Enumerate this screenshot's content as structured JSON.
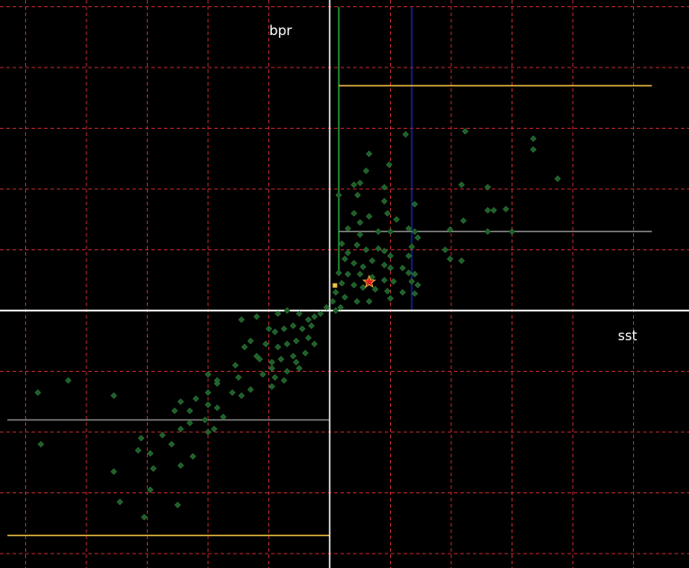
{
  "chart_data": {
    "type": "scatter",
    "title": "",
    "xlabel": "sst",
    "ylabel": "bpr",
    "grid": true,
    "legend": "none",
    "xlim": [
      -5.4,
      5.8
    ],
    "ylim": [
      -4.2,
      5.0
    ],
    "origin": [
      0,
      0
    ],
    "colors": {
      "background": "#000000",
      "grid": "#c0272d",
      "axes": "#ffffff",
      "points": "#1f5f2a",
      "highlight_star": "#e02020",
      "green_line": "#2fd04a",
      "blue_line": "#1a2ad0",
      "yellow_line": "#f0c040",
      "gray_line": "#8a8a8a"
    },
    "reference_lines": [
      {
        "kind": "vertical",
        "x": 0.15,
        "y_range": [
          0.6,
          5.0
        ],
        "color": "green"
      },
      {
        "kind": "vertical",
        "x": 1.35,
        "y_range": [
          0.0,
          5.0
        ],
        "color": "blue"
      },
      {
        "kind": "horizontal",
        "y": 3.7,
        "x_range": [
          0.15,
          5.3
        ],
        "color": "yellow"
      },
      {
        "kind": "horizontal",
        "y": 1.3,
        "x_range": [
          0.15,
          5.3
        ],
        "color": "gray"
      },
      {
        "kind": "horizontal",
        "y": -1.8,
        "x_range": [
          -5.3,
          0.0
        ],
        "color": "gray"
      },
      {
        "kind": "horizontal",
        "y": -3.7,
        "x_range": [
          -5.3,
          0.0
        ],
        "color": "yellow"
      }
    ],
    "highlight": {
      "x": 0.65,
      "y": 0.47,
      "marker": "star"
    },
    "points": [
      [
        1.25,
        2.9
      ],
      [
        0.65,
        2.58
      ],
      [
        0.98,
        2.4
      ],
      [
        2.23,
        2.95
      ],
      [
        3.35,
        2.83
      ],
      [
        3.35,
        2.65
      ],
      [
        3.75,
        2.17
      ],
      [
        2.17,
        2.07
      ],
      [
        2.6,
        2.03
      ],
      [
        0.15,
        1.9
      ],
      [
        0.4,
        2.07
      ],
      [
        0.46,
        1.9
      ],
      [
        0.9,
        2.03
      ],
      [
        0.9,
        1.8
      ],
      [
        1.4,
        1.75
      ],
      [
        2.7,
        1.65
      ],
      [
        2.6,
        1.65
      ],
      [
        2.9,
        1.67
      ],
      [
        0.4,
        1.6
      ],
      [
        0.5,
        1.45
      ],
      [
        0.65,
        1.55
      ],
      [
        0.95,
        1.6
      ],
      [
        1.1,
        1.5
      ],
      [
        2.2,
        1.48
      ],
      [
        1.98,
        1.33
      ],
      [
        2.6,
        1.3
      ],
      [
        3.0,
        1.3
      ],
      [
        0.3,
        1.35
      ],
      [
        0.5,
        1.25
      ],
      [
        0.8,
        1.3
      ],
      [
        1.0,
        1.3
      ],
      [
        1.3,
        1.35
      ],
      [
        1.4,
        1.3
      ],
      [
        1.45,
        1.2
      ],
      [
        0.2,
        1.1
      ],
      [
        0.45,
        1.08
      ],
      [
        0.6,
        1.0
      ],
      [
        0.8,
        1.02
      ],
      [
        0.9,
        0.98
      ],
      [
        1.0,
        0.9
      ],
      [
        1.3,
        0.9
      ],
      [
        1.9,
        1.0
      ],
      [
        1.98,
        0.85
      ],
      [
        2.17,
        0.82
      ],
      [
        0.25,
        0.85
      ],
      [
        0.4,
        0.78
      ],
      [
        0.55,
        0.72
      ],
      [
        0.7,
        0.82
      ],
      [
        0.9,
        0.75
      ],
      [
        1.0,
        0.7
      ],
      [
        1.2,
        0.7
      ],
      [
        1.3,
        0.62
      ],
      [
        1.4,
        0.6
      ],
      [
        0.15,
        0.62
      ],
      [
        0.3,
        0.6
      ],
      [
        0.5,
        0.6
      ],
      [
        0.7,
        0.55
      ],
      [
        0.9,
        0.5
      ],
      [
        1.05,
        0.48
      ],
      [
        1.35,
        0.48
      ],
      [
        1.45,
        0.42
      ],
      [
        0.2,
        0.45
      ],
      [
        0.4,
        0.42
      ],
      [
        0.55,
        0.38
      ],
      [
        0.75,
        0.35
      ],
      [
        0.95,
        0.32
      ],
      [
        1.2,
        0.3
      ],
      [
        1.4,
        0.28
      ],
      [
        0.1,
        0.3
      ],
      [
        0.25,
        0.22
      ],
      [
        0.45,
        0.15
      ],
      [
        0.65,
        0.15
      ],
      [
        1.0,
        0.2
      ],
      [
        0.05,
        0.15
      ],
      [
        0.18,
        0.05
      ],
      [
        0.1,
        0.0
      ],
      [
        -0.05,
        0.05
      ],
      [
        -0.15,
        -0.05
      ],
      [
        -0.25,
        -0.1
      ],
      [
        -0.35,
        -0.15
      ],
      [
        -0.5,
        -0.05
      ],
      [
        -0.7,
        0.0
      ],
      [
        -0.85,
        -0.05
      ],
      [
        -1.2,
        -0.1
      ],
      [
        -1.45,
        -0.15
      ],
      [
        -0.3,
        -0.25
      ],
      [
        -0.45,
        -0.3
      ],
      [
        -0.6,
        -0.25
      ],
      [
        -0.75,
        -0.3
      ],
      [
        -0.9,
        -0.35
      ],
      [
        -1.0,
        -0.3
      ],
      [
        -0.35,
        -0.45
      ],
      [
        -0.55,
        -0.5
      ],
      [
        -0.7,
        -0.55
      ],
      [
        -0.85,
        -0.6
      ],
      [
        -1.05,
        -0.55
      ],
      [
        -1.3,
        -0.5
      ],
      [
        -0.4,
        -0.7
      ],
      [
        -0.6,
        -0.75
      ],
      [
        -0.8,
        -0.8
      ],
      [
        -0.95,
        -0.85
      ],
      [
        -1.15,
        -0.8
      ],
      [
        -1.55,
        -0.9
      ],
      [
        -0.5,
        -0.95
      ],
      [
        -0.7,
        -1.0
      ],
      [
        -0.9,
        -1.1
      ],
      [
        -1.1,
        -1.05
      ],
      [
        -1.5,
        -1.1
      ],
      [
        -1.85,
        -1.2
      ],
      [
        -0.95,
        -1.25
      ],
      [
        -1.3,
        -1.3
      ],
      [
        -1.6,
        -1.35
      ],
      [
        -2.0,
        -1.35
      ],
      [
        -2.2,
        -1.45
      ],
      [
        -2.45,
        -1.5
      ],
      [
        -1.45,
        -1.4
      ],
      [
        -1.85,
        -1.6
      ],
      [
        -2.0,
        -1.55
      ],
      [
        -2.3,
        -1.65
      ],
      [
        -2.55,
        -1.65
      ],
      [
        -1.75,
        -1.75
      ],
      [
        -2.05,
        -1.8
      ],
      [
        -2.3,
        -1.85
      ],
      [
        -1.9,
        -1.95
      ],
      [
        -2.45,
        -1.95
      ],
      [
        -2.0,
        -2.0
      ],
      [
        -2.75,
        -2.05
      ],
      [
        -3.1,
        -2.1
      ],
      [
        -2.6,
        -2.2
      ],
      [
        -2.25,
        -2.4
      ],
      [
        -2.95,
        -2.35
      ],
      [
        -3.15,
        -2.3
      ],
      [
        -2.45,
        -2.55
      ],
      [
        -2.9,
        -2.6
      ],
      [
        -3.55,
        -2.65
      ],
      [
        -4.75,
        -2.2
      ],
      [
        -2.95,
        -2.95
      ],
      [
        -2.5,
        -3.2
      ],
      [
        -3.45,
        -3.15
      ],
      [
        -3.05,
        -3.4
      ],
      [
        -4.8,
        -1.35
      ],
      [
        -4.3,
        -1.15
      ],
      [
        -3.55,
        -1.4
      ],
      [
        -2.0,
        -1.05
      ],
      [
        -1.85,
        -1.15
      ],
      [
        -1.2,
        -0.75
      ],
      [
        -1.4,
        -0.6
      ],
      [
        -0.95,
        -0.95
      ],
      [
        -0.75,
        -1.15
      ],
      [
        -0.55,
        -0.85
      ],
      [
        -0.25,
        -0.55
      ],
      [
        0.6,
        2.3
      ],
      [
        0.5,
        2.1
      ],
      [
        1.35,
        1.05
      ],
      [
        0.3,
        0.95
      ]
    ]
  }
}
